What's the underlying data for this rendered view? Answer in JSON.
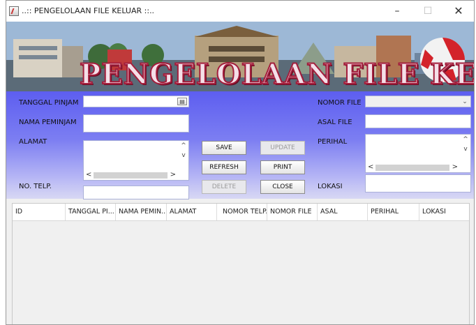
{
  "window": {
    "title": "..:: PENGELOLAAN FILE KELUAR ::..",
    "minimize_glyph": "–",
    "maximize_glyph": "☐",
    "close_glyph": "✕"
  },
  "banner": {
    "title": "PENGELOLAAN FILE KELUAR"
  },
  "form": {
    "tanggal_pinjam_label": "TANGGAL PINJAM",
    "nama_peminjam_label": "NAMA PEMINJAM",
    "alamat_label": "ALAMAT",
    "no_telp_label": "NO. TELP.",
    "nomor_file_label": "NOMOR FILE",
    "asal_file_label": "ASAL FILE",
    "perihal_label": "PERIHAL",
    "lokasi_label": "LOKASI",
    "tanggal_pinjam_value": "",
    "nama_peminjam_value": "",
    "alamat_value": "",
    "no_telp_value": "",
    "nomor_file_value": "",
    "asal_file_value": "",
    "perihal_value": "",
    "lokasi_value": ""
  },
  "buttons": {
    "save": "SAVE",
    "update": "UPDATE",
    "refresh": "REFRESH",
    "print": "PRINT",
    "delete": "DELETE",
    "close": "CLOSE"
  },
  "table": {
    "columns": [
      "ID",
      "TANGGAL PI...",
      "NAMA PEMIN...",
      "ALAMAT",
      "NOMOR TELP.",
      "NOMOR FILE",
      "ASAL",
      "PERIHAL",
      "LOKASI"
    ],
    "rows": []
  },
  "icons": {
    "app": "java-app-icon",
    "calendar": "calendar-icon",
    "dropdown": "chevron-down-icon"
  }
}
